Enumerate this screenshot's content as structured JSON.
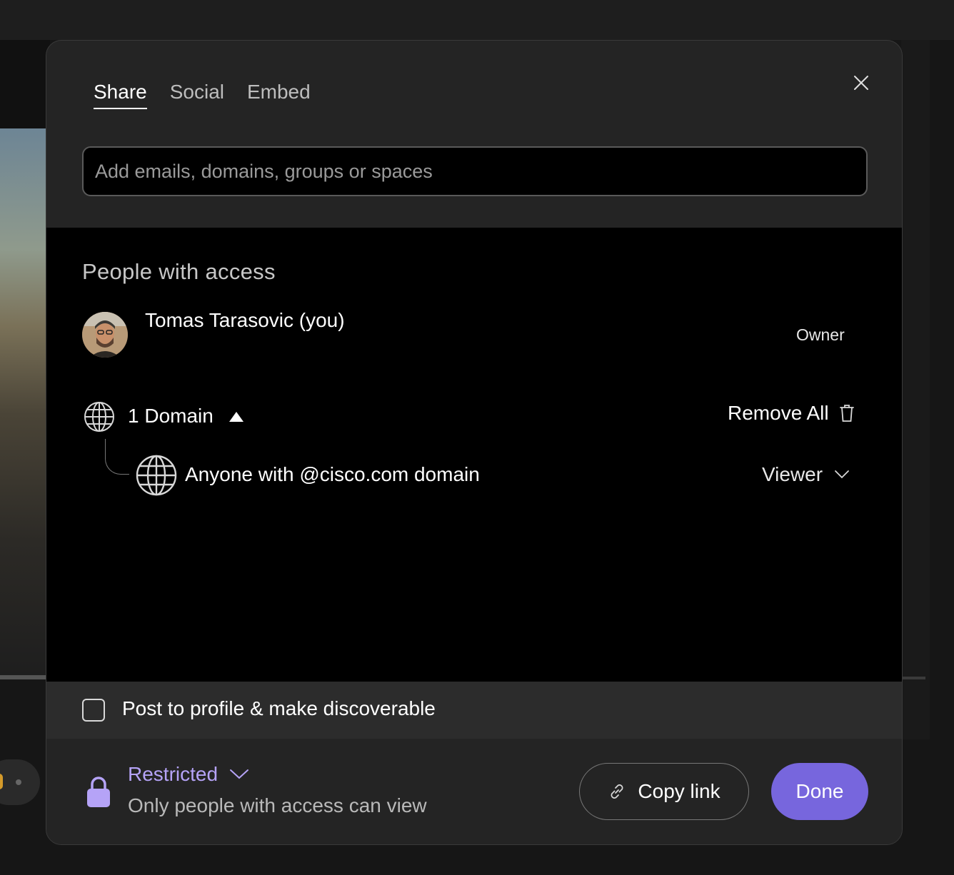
{
  "tabs": [
    {
      "label": "Share",
      "active": true
    },
    {
      "label": "Social",
      "active": false
    },
    {
      "label": "Embed",
      "active": false
    }
  ],
  "invite": {
    "placeholder": "Add emails, domains, groups or spaces",
    "value": ""
  },
  "access": {
    "title": "People with access",
    "people": [
      {
        "name": "Tomas Tarasovic (you)",
        "role": "Owner"
      }
    ],
    "domain_group": {
      "label": "1 Domain",
      "remove_all_label": "Remove All",
      "entries": [
        {
          "label": "Anyone with @cisco.com domain",
          "role": "Viewer"
        }
      ]
    }
  },
  "post": {
    "label": "Post to profile & make discoverable",
    "checked": false
  },
  "footer": {
    "access_level": "Restricted",
    "access_description": "Only people with access can view",
    "copy_label": "Copy link",
    "done_label": "Done"
  },
  "colors": {
    "accent": "#7766dd",
    "accent_text": "#b5a3f7",
    "panel": "#000000",
    "modal": "#242424"
  },
  "icons": [
    "close-icon",
    "globe-icon",
    "caret-up-icon",
    "trash-icon",
    "chevron-down-icon",
    "lock-icon",
    "link-icon"
  ]
}
